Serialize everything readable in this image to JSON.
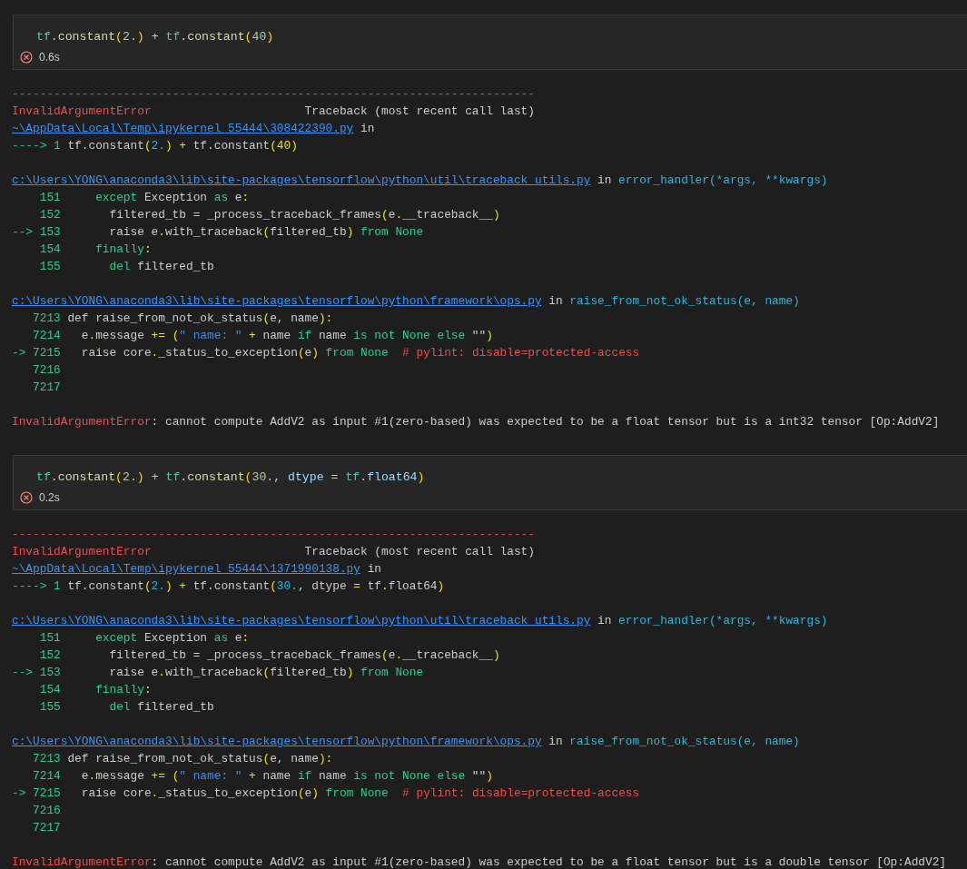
{
  "cells": [
    {
      "code": [
        {
          "text": "tf",
          "kind": "ns"
        },
        {
          "text": ".",
          "kind": "plain"
        },
        {
          "text": "constant",
          "kind": "method"
        },
        {
          "text": "(",
          "kind": "bracket"
        },
        {
          "text": "2.",
          "kind": "literal"
        },
        {
          "text": ")",
          "kind": "bracket"
        },
        {
          "text": " + ",
          "kind": "plain"
        },
        {
          "text": "tf",
          "kind": "ns"
        },
        {
          "text": ".",
          "kind": "plain"
        },
        {
          "text": "constant",
          "kind": "method"
        },
        {
          "text": "(",
          "kind": "bracket"
        },
        {
          "text": "40",
          "kind": "literal"
        },
        {
          "text": ")",
          "kind": "bracket"
        }
      ],
      "status": {
        "kind": "error",
        "time": "0.6s"
      },
      "output": [
        [
          [
            {
              "text": "---------------------------------------------------------------------------",
              "kind": "error"
            }
          ],
          [
            {
              "text": "InvalidArgumentError",
              "kind": "error"
            },
            {
              "text": "                      Traceback (most recent call last)",
              "kind": "plain"
            }
          ],
          [
            {
              "text": "~\\AppData\\Local\\Temp\\ipykernel_55444\\308422390.py",
              "kind": "link"
            },
            {
              "text": " in",
              "kind": "plain"
            }
          ],
          [
            {
              "text": "---->",
              "kind": "green"
            },
            {
              "text": "1",
              "kind": "lineno"
            },
            {
              "text": " tf.constant",
              "kind": "plain"
            },
            {
              "text": "(",
              "kind": "paren"
            },
            {
              "text": "2.",
              "kind": "number"
            },
            {
              "text": ")",
              "kind": "paren"
            },
            {
              "text": " +",
              "kind": "paren"
            },
            {
              "text": " tf.constant",
              "kind": "plain"
            },
            {
              "text": "(40)",
              "kind": "paren"
            }
          ]
        ],
        [
          [
            {
              "text": "c:\\Users\\YONG\\anaconda3\\lib\\site-packages\\tensorflow\\python\\util\\traceback_utils.py",
              "kind": "link"
            },
            {
              "text": " in ",
              "kind": "plain"
            },
            {
              "text": "error_handler(*args, **kwargs)",
              "kind": "func"
            }
          ],
          [
            {
              "text": "151",
              "kind": "lineno"
            },
            {
              "text": "     except",
              "kind": "keyword"
            },
            {
              "text": " Exception ",
              "kind": "plain"
            },
            {
              "text": "as",
              "kind": "keyword"
            },
            {
              "text": " e",
              "kind": "plain"
            },
            {
              "text": ":",
              "kind": "paren"
            }
          ],
          [
            {
              "text": "152",
              "kind": "lineno"
            },
            {
              "text": "       filtered_tb = _process_traceback_frames",
              "kind": "plain"
            },
            {
              "text": "(",
              "kind": "paren"
            },
            {
              "text": "e",
              "kind": "plain"
            },
            {
              "text": ".",
              "kind": "paren"
            },
            {
              "text": "__traceback__",
              "kind": "plain"
            },
            {
              "text": ")",
              "kind": "paren"
            }
          ],
          [
            {
              "text": "-->",
              "kind": "green"
            },
            {
              "text": "153",
              "kind": "lineno"
            },
            {
              "text": "       raise e",
              "kind": "plain"
            },
            {
              "text": ".",
              "kind": "paren"
            },
            {
              "text": "with_traceback",
              "kind": "plain"
            },
            {
              "text": "(",
              "kind": "paren"
            },
            {
              "text": "filtered_tb",
              "kind": "plain"
            },
            {
              "text": ")",
              "kind": "paren"
            },
            {
              "text": " from None",
              "kind": "keyword"
            }
          ],
          [
            {
              "text": "154",
              "kind": "lineno"
            },
            {
              "text": "     finally",
              "kind": "keyword"
            },
            {
              "text": ":",
              "kind": "paren"
            }
          ],
          [
            {
              "text": "155",
              "kind": "lineno"
            },
            {
              "text": "       del",
              "kind": "keyword"
            },
            {
              "text": " filtered_tb",
              "kind": "plain"
            }
          ]
        ],
        [
          [
            {
              "text": "c:\\Users\\YONG\\anaconda3\\lib\\site-packages\\tensorflow\\python\\framework\\ops.py",
              "kind": "link"
            },
            {
              "text": " in ",
              "kind": "plain"
            },
            {
              "text": "raise_from_not_ok_status(e, name)",
              "kind": "func"
            }
          ],
          [
            {
              "text": "7213",
              "kind": "lineno"
            },
            {
              "text": " def raise_from_not_ok_status",
              "kind": "plain"
            },
            {
              "text": "(",
              "kind": "paren"
            },
            {
              "text": "e, name",
              "kind": "plain"
            },
            {
              "text": "):",
              "kind": "paren"
            }
          ],
          [
            {
              "text": "7214",
              "kind": "lineno"
            },
            {
              "text": "   e",
              "kind": "plain"
            },
            {
              "text": ".",
              "kind": "paren"
            },
            {
              "text": "message ",
              "kind": "plain"
            },
            {
              "text": "+=",
              "kind": "paren"
            },
            {
              "text": " (",
              "kind": "paren"
            },
            {
              "text": "\" name: \"",
              "kind": "string"
            },
            {
              "text": " +",
              "kind": "paren"
            },
            {
              "text": " name ",
              "kind": "plain"
            },
            {
              "text": "if",
              "kind": "keyword"
            },
            {
              "text": " name ",
              "kind": "plain"
            },
            {
              "text": "is not None else",
              "kind": "keyword"
            },
            {
              "text": " \"\"",
              "kind": "plain"
            },
            {
              "text": ")",
              "kind": "paren"
            }
          ],
          [
            {
              "text": "->",
              "kind": "green"
            },
            {
              "text": "7215",
              "kind": "lineno"
            },
            {
              "text": "   raise core",
              "kind": "plain"
            },
            {
              "text": ".",
              "kind": "paren"
            },
            {
              "text": "_status_to_exception",
              "kind": "plain"
            },
            {
              "text": "(",
              "kind": "paren"
            },
            {
              "text": "e",
              "kind": "plain"
            },
            {
              "text": ")",
              "kind": "paren"
            },
            {
              "text": " from None",
              "kind": "keyword"
            },
            {
              "text": "  # pylint: disable=protected-access",
              "kind": "comment"
            }
          ],
          [
            {
              "text": "7216",
              "kind": "lineno"
            }
          ],
          [
            {
              "text": "7217",
              "kind": "lineno"
            }
          ]
        ],
        [
          [
            {
              "text": "InvalidArgumentError",
              "kind": "error"
            },
            {
              "text": ": cannot compute AddV2 as input #1(zero-based) was expected to be a float tensor but is a int32 tensor [Op:AddV2]",
              "kind": "plain"
            }
          ]
        ]
      ]
    },
    {
      "code": [
        {
          "text": "tf",
          "kind": "ns"
        },
        {
          "text": ".",
          "kind": "plain"
        },
        {
          "text": "constant",
          "kind": "method"
        },
        {
          "text": "(",
          "kind": "bracket"
        },
        {
          "text": "2.",
          "kind": "literal"
        },
        {
          "text": ")",
          "kind": "bracket"
        },
        {
          "text": " + ",
          "kind": "plain"
        },
        {
          "text": "tf",
          "kind": "ns"
        },
        {
          "text": ".",
          "kind": "plain"
        },
        {
          "text": "constant",
          "kind": "method"
        },
        {
          "text": "(",
          "kind": "bracket"
        },
        {
          "text": "30.",
          "kind": "literal"
        },
        {
          "text": ", ",
          "kind": "plain"
        },
        {
          "text": "dtype",
          "kind": "param"
        },
        {
          "text": " = ",
          "kind": "plain"
        },
        {
          "text": "tf",
          "kind": "ns"
        },
        {
          "text": ".",
          "kind": "plain"
        },
        {
          "text": "float64",
          "kind": "param"
        },
        {
          "text": ")",
          "kind": "bracket"
        }
      ],
      "status": {
        "kind": "error",
        "time": "0.2s"
      },
      "output": [
        [
          [
            {
              "text": "---------------------------------------------------------------------------",
              "kind": "error"
            }
          ],
          [
            {
              "text": "InvalidArgumentError",
              "kind": "error"
            },
            {
              "text": "                      Traceback (most recent call last)",
              "kind": "plain"
            }
          ],
          [
            {
              "text": "~\\AppData\\Local\\Temp\\ipykernel_55444\\1371990138.py",
              "kind": "link"
            },
            {
              "text": " in",
              "kind": "plain"
            }
          ],
          [
            {
              "text": "---->",
              "kind": "green"
            },
            {
              "text": "1",
              "kind": "lineno"
            },
            {
              "text": " tf.constant",
              "kind": "plain"
            },
            {
              "text": "(",
              "kind": "paren"
            },
            {
              "text": "2.",
              "kind": "number"
            },
            {
              "text": ")",
              "kind": "paren"
            },
            {
              "text": " +",
              "kind": "paren"
            },
            {
              "text": " tf.constant",
              "kind": "plain"
            },
            {
              "text": "(",
              "kind": "paren"
            },
            {
              "text": "30.",
              "kind": "number"
            },
            {
              "text": ", dtype ",
              "kind": "plain"
            },
            {
              "text": "=",
              "kind": "paren"
            },
            {
              "text": " tf",
              "kind": "plain"
            },
            {
              "text": ".",
              "kind": "paren"
            },
            {
              "text": "float64",
              "kind": "plain"
            },
            {
              "text": ")",
              "kind": "paren"
            }
          ]
        ],
        [
          [
            {
              "text": "c:\\Users\\YONG\\anaconda3\\lib\\site-packages\\tensorflow\\python\\util\\traceback_utils.py",
              "kind": "link"
            },
            {
              "text": " in ",
              "kind": "plain"
            },
            {
              "text": "error_handler(*args, **kwargs)",
              "kind": "func"
            }
          ],
          [
            {
              "text": "151",
              "kind": "lineno"
            },
            {
              "text": "     except",
              "kind": "keyword"
            },
            {
              "text": " Exception ",
              "kind": "plain"
            },
            {
              "text": "as",
              "kind": "keyword"
            },
            {
              "text": " e",
              "kind": "plain"
            },
            {
              "text": ":",
              "kind": "paren"
            }
          ],
          [
            {
              "text": "152",
              "kind": "lineno"
            },
            {
              "text": "       filtered_tb = _process_traceback_frames",
              "kind": "plain"
            },
            {
              "text": "(",
              "kind": "paren"
            },
            {
              "text": "e",
              "kind": "plain"
            },
            {
              "text": ".",
              "kind": "paren"
            },
            {
              "text": "__traceback__",
              "kind": "plain"
            },
            {
              "text": ")",
              "kind": "paren"
            }
          ],
          [
            {
              "text": "-->",
              "kind": "green"
            },
            {
              "text": "153",
              "kind": "lineno"
            },
            {
              "text": "       raise e",
              "kind": "plain"
            },
            {
              "text": ".",
              "kind": "paren"
            },
            {
              "text": "with_traceback",
              "kind": "plain"
            },
            {
              "text": "(",
              "kind": "paren"
            },
            {
              "text": "filtered_tb",
              "kind": "plain"
            },
            {
              "text": ")",
              "kind": "paren"
            },
            {
              "text": " from None",
              "kind": "keyword"
            }
          ],
          [
            {
              "text": "154",
              "kind": "lineno"
            },
            {
              "text": "     finally",
              "kind": "keyword"
            },
            {
              "text": ":",
              "kind": "paren"
            }
          ],
          [
            {
              "text": "155",
              "kind": "lineno"
            },
            {
              "text": "       del",
              "kind": "keyword"
            },
            {
              "text": " filtered_tb",
              "kind": "plain"
            }
          ]
        ],
        [
          [
            {
              "text": "c:\\Users\\YONG\\anaconda3\\lib\\site-packages\\tensorflow\\python\\framework\\ops.py",
              "kind": "link"
            },
            {
              "text": " in ",
              "kind": "plain"
            },
            {
              "text": "raise_from_not_ok_status(e, name)",
              "kind": "func"
            }
          ],
          [
            {
              "text": "7213",
              "kind": "lineno"
            },
            {
              "text": " def raise_from_not_ok_status",
              "kind": "plain"
            },
            {
              "text": "(",
              "kind": "paren"
            },
            {
              "text": "e, name",
              "kind": "plain"
            },
            {
              "text": "):",
              "kind": "paren"
            }
          ],
          [
            {
              "text": "7214",
              "kind": "lineno"
            },
            {
              "text": "   e",
              "kind": "plain"
            },
            {
              "text": ".",
              "kind": "paren"
            },
            {
              "text": "message ",
              "kind": "plain"
            },
            {
              "text": "+=",
              "kind": "paren"
            },
            {
              "text": " (",
              "kind": "paren"
            },
            {
              "text": "\" name: \"",
              "kind": "string"
            },
            {
              "text": " +",
              "kind": "paren"
            },
            {
              "text": " name ",
              "kind": "plain"
            },
            {
              "text": "if",
              "kind": "keyword"
            },
            {
              "text": " name ",
              "kind": "plain"
            },
            {
              "text": "is not None else",
              "kind": "keyword"
            },
            {
              "text": " \"\"",
              "kind": "plain"
            },
            {
              "text": ")",
              "kind": "paren"
            }
          ],
          [
            {
              "text": "->",
              "kind": "green"
            },
            {
              "text": "7215",
              "kind": "lineno"
            },
            {
              "text": "   raise core",
              "kind": "plain"
            },
            {
              "text": ".",
              "kind": "paren"
            },
            {
              "text": "_status_to_exception",
              "kind": "plain"
            },
            {
              "text": "(",
              "kind": "paren"
            },
            {
              "text": "e",
              "kind": "plain"
            },
            {
              "text": ")",
              "kind": "paren"
            },
            {
              "text": " from None",
              "kind": "keyword"
            },
            {
              "text": "  # pylint: disable=protected-access",
              "kind": "comment"
            }
          ],
          [
            {
              "text": "7216",
              "kind": "lineno"
            }
          ],
          [
            {
              "text": "7217",
              "kind": "lineno"
            }
          ]
        ],
        [
          [
            {
              "text": "InvalidArgumentError",
              "kind": "error"
            },
            {
              "text": ": cannot compute AddV2 as input #1(zero-based) was expected to be a float tensor but is a double tensor [Op:AddV2]",
              "kind": "plain"
            }
          ]
        ]
      ]
    }
  ]
}
